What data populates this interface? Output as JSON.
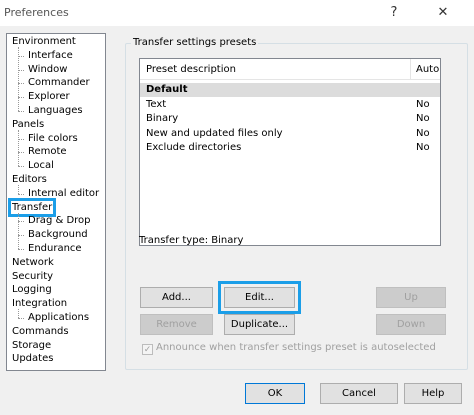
{
  "window": {
    "title": "Preferences",
    "help_glyph": "?",
    "close_glyph": "✕"
  },
  "tree": {
    "items": [
      {
        "label": "Environment",
        "level": 0
      },
      {
        "label": "Interface",
        "level": 1
      },
      {
        "label": "Window",
        "level": 1
      },
      {
        "label": "Commander",
        "level": 1
      },
      {
        "label": "Explorer",
        "level": 1
      },
      {
        "label": "Languages",
        "level": 1
      },
      {
        "label": "Panels",
        "level": 0
      },
      {
        "label": "File colors",
        "level": 1
      },
      {
        "label": "Remote",
        "level": 1
      },
      {
        "label": "Local",
        "level": 1
      },
      {
        "label": "Editors",
        "level": 0
      },
      {
        "label": "Internal editor",
        "level": 1
      },
      {
        "label": "Transfer",
        "level": 0,
        "selected": true
      },
      {
        "label": "Drag & Drop",
        "level": 1
      },
      {
        "label": "Background",
        "level": 1
      },
      {
        "label": "Endurance",
        "level": 1
      },
      {
        "label": "Network",
        "level": 0
      },
      {
        "label": "Security",
        "level": 0
      },
      {
        "label": "Logging",
        "level": 0
      },
      {
        "label": "Integration",
        "level": 0
      },
      {
        "label": "Applications",
        "level": 1
      },
      {
        "label": "Commands",
        "level": 0
      },
      {
        "label": "Storage",
        "level": 0
      },
      {
        "label": "Updates",
        "level": 0
      }
    ]
  },
  "presets": {
    "group_label": "Transfer settings presets",
    "columns": [
      "Preset description",
      "Auto"
    ],
    "rows": [
      {
        "description": "Default",
        "auto": ""
      },
      {
        "description": "Text",
        "auto": "No"
      },
      {
        "description": "Binary",
        "auto": "No"
      },
      {
        "description": "New and updated files only",
        "auto": "No"
      },
      {
        "description": "Exclude directories",
        "auto": "No"
      }
    ],
    "transfer_type": "Transfer type: Binary",
    "buttons": {
      "add": "Add...",
      "edit": "Edit...",
      "up": "Up",
      "remove": "Remove",
      "duplicate": "Duplicate...",
      "down": "Down"
    },
    "autoselect_label": "Announce when transfer settings preset is autoselected",
    "autoselect_checked": true
  },
  "footer": {
    "ok": "OK",
    "cancel": "Cancel",
    "help": "Help"
  },
  "colors": {
    "highlight": "#1b9ee8",
    "dialog_bg": "#f0f0f0"
  }
}
